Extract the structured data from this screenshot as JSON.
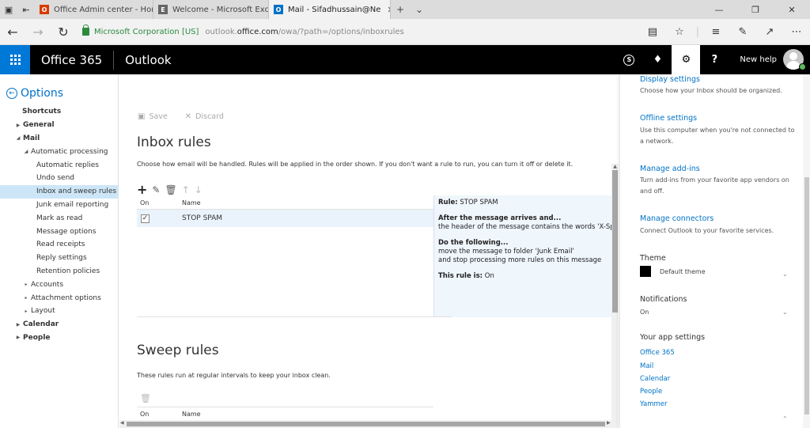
{
  "browser": {
    "tabs": [
      {
        "title": "Office Admin center - Home",
        "favicon_color": "#d83b01"
      },
      {
        "title": "Welcome - Microsoft Exchange",
        "favicon_color": "#444444"
      },
      {
        "title": "Mail - Sifadhussain@Ne",
        "favicon_color": "#0072c6",
        "active": true
      }
    ],
    "corp_label": "Microsoft Corporation [US]",
    "url_prefix": "outlook.",
    "url_host": "office.com",
    "url_path": "/owa/?path=/options/inboxrules"
  },
  "header": {
    "brand": "Office 365",
    "app": "Outlook",
    "user": "New help"
  },
  "leftnav": {
    "title": "Options",
    "items": [
      {
        "label": "Shortcuts"
      },
      {
        "label": "General"
      },
      {
        "label": "Mail"
      },
      {
        "label": "Automatic processing"
      },
      {
        "label": "Automatic replies"
      },
      {
        "label": "Undo send"
      },
      {
        "label": "Inbox and sweep rules"
      },
      {
        "label": "Junk email reporting"
      },
      {
        "label": "Mark as read"
      },
      {
        "label": "Message options"
      },
      {
        "label": "Read receipts"
      },
      {
        "label": "Reply settings"
      },
      {
        "label": "Retention policies"
      },
      {
        "label": "Accounts"
      },
      {
        "label": "Attachment options"
      },
      {
        "label": "Layout"
      },
      {
        "label": "Calendar"
      },
      {
        "label": "People"
      }
    ]
  },
  "main": {
    "save_label": "Save",
    "discard_label": "Discard",
    "inbox_title": "Inbox rules",
    "inbox_desc": "Choose how email will be handled. Rules will be applied in the order shown. If you don't want a rule to run, you can turn it off or delete it.",
    "col_on": "On",
    "col_name": "Name",
    "rules": [
      {
        "name": "STOP SPAM",
        "enabled": true
      }
    ],
    "detail": {
      "rule_label": "Rule:",
      "rule_name": "STOP SPAM",
      "after_heading": "After the message arrives and...",
      "condition": "the header of the message contains the words 'X-Sp",
      "do_heading": "Do the following...",
      "action1": "move the message to folder 'Junk Email'",
      "action2": "and stop processing more rules on this message",
      "status_label": "This rule is:",
      "status_value": "On"
    },
    "sweep_title": "Sweep rules",
    "sweep_desc": "These rules run at regular intervals to keep your inbox clean.",
    "sweep_col_on": "On",
    "sweep_col_name": "Name"
  },
  "settings_pane": {
    "display_link": "Display settings",
    "display_desc": "Choose how your Inbox should be organized.",
    "offline_link": "Offline settings",
    "offline_desc": "Use this computer when you're not connected to a network.",
    "addins_link": "Manage add-ins",
    "addins_desc": "Turn add-ins from your favorite app vendors on and off.",
    "connectors_link": "Manage connectors",
    "connectors_desc": "Connect Outlook to your favorite services.",
    "theme_label": "Theme",
    "theme_value": "Default theme",
    "notifications_label": "Notifications",
    "notifications_value": "On",
    "app_settings_label": "Your app settings",
    "apps": [
      "Office 365",
      "Mail",
      "Calendar",
      "People",
      "Yammer"
    ]
  },
  "colors": {
    "accent": "#0072c6",
    "waffle": "#0078d7",
    "selected_nav": "#cde6f7",
    "secure_green": "#2b8a3e"
  }
}
